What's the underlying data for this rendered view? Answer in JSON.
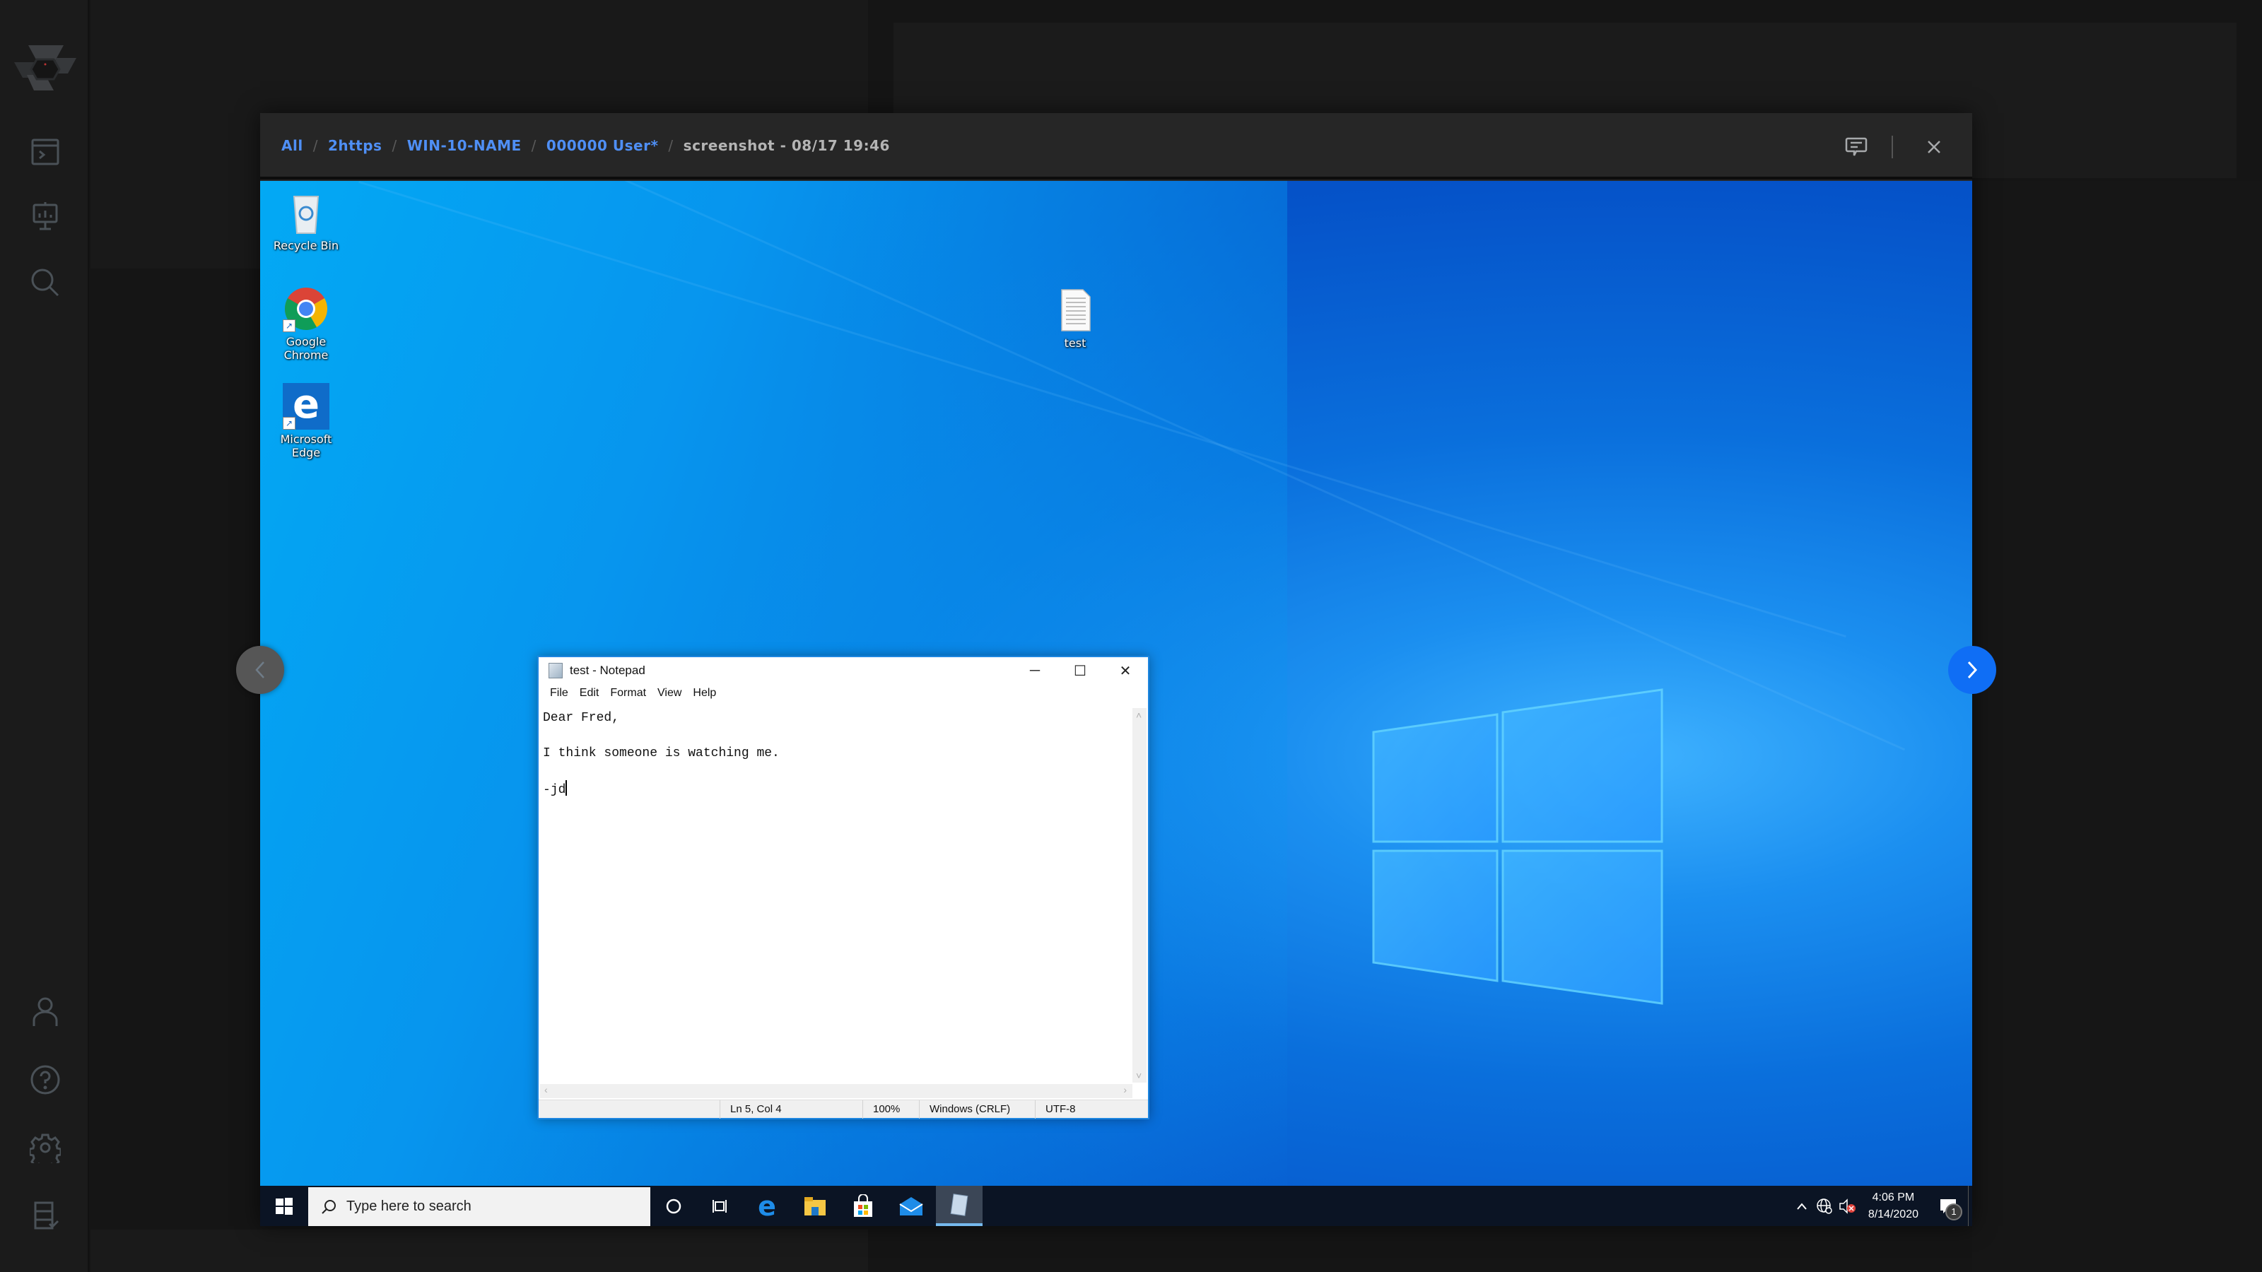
{
  "app": {
    "sidebar": {
      "logo": "hexagon-logo",
      "top_items": [
        {
          "name": "terminal",
          "icon": "terminal-window-icon"
        },
        {
          "name": "presentation",
          "icon": "chart-board-icon"
        },
        {
          "name": "search",
          "icon": "search-icon"
        }
      ],
      "bottom_items": [
        {
          "name": "profile",
          "icon": "user-icon"
        },
        {
          "name": "help",
          "icon": "help-circle-icon"
        },
        {
          "name": "settings",
          "icon": "gear-icon"
        },
        {
          "name": "tasks",
          "icon": "server-check-icon"
        }
      ]
    }
  },
  "viewer": {
    "breadcrumb": {
      "links": [
        "All",
        "2https",
        "WIN-10-NAME",
        "000000 User*"
      ],
      "separator": "/",
      "current": "screenshot - 08/17 19:46"
    },
    "actions": {
      "comment_icon": "comment-icon",
      "close_icon": "close-icon"
    },
    "nav": {
      "prev_icon": "chevron-left-icon",
      "next_icon": "chevron-right-icon"
    },
    "colors": {
      "link": "#4f8ff5",
      "next_button": "#0f6ef5",
      "prev_button": "#565656"
    }
  },
  "desktop": {
    "icons": [
      {
        "label": "Recycle Bin",
        "icon": "recycle-bin-icon"
      },
      {
        "label": "Google Chrome",
        "icon": "chrome-icon"
      },
      {
        "label": "Microsoft Edge",
        "icon": "edge-icon"
      },
      {
        "label": "test",
        "icon": "text-file-icon"
      }
    ],
    "notepad": {
      "title": "test - Notepad",
      "controls": {
        "minimize": "─",
        "maximize": "☐",
        "close": "✕"
      },
      "menu": [
        "File",
        "Edit",
        "Format",
        "View",
        "Help"
      ],
      "lines": [
        "Dear Fred,",
        "",
        "I think someone is watching me.",
        "",
        "-jd"
      ],
      "status": {
        "position": "Ln 5, Col 4",
        "zoom": "100%",
        "line_ending": "Windows (CRLF)",
        "encoding": "UTF-8"
      }
    },
    "taskbar": {
      "search_placeholder": "Type here to search",
      "apps": [
        "cortana-icon",
        "task-view-icon",
        "edge-icon",
        "file-explorer-icon",
        "store-icon",
        "mail-icon",
        "notepad-icon"
      ],
      "clock": {
        "time": "4:06 PM",
        "date": "8/14/2020"
      },
      "notifications_count": "1"
    }
  }
}
